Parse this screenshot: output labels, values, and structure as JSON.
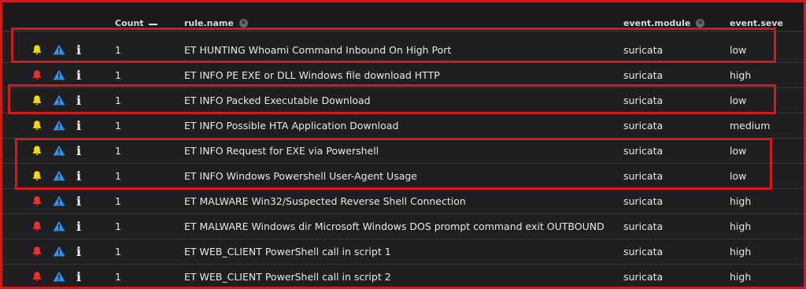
{
  "columns": {
    "count": "Count",
    "rule_name": "rule.name",
    "event_module": "event.module",
    "event_severity": "event.seve"
  },
  "colors": {
    "bell_yellow": "#f5d90a",
    "bell_red": "#e5342f",
    "warning_blue": "#3b8ee8",
    "highlight_red": "#d11a1a"
  },
  "rows": [
    {
      "bell": "yellow",
      "count": "1",
      "rule_name": "ET HUNTING Whoami Command Inbound On High Port",
      "module": "suricata",
      "severity": "low"
    },
    {
      "bell": "red",
      "count": "1",
      "rule_name": "ET INFO PE EXE or DLL Windows file download HTTP",
      "module": "suricata",
      "severity": "high"
    },
    {
      "bell": "yellow",
      "count": "1",
      "rule_name": "ET INFO Packed Executable Download",
      "module": "suricata",
      "severity": "low"
    },
    {
      "bell": "yellow",
      "count": "1",
      "rule_name": "ET INFO Possible HTA Application Download",
      "module": "suricata",
      "severity": "medium"
    },
    {
      "bell": "yellow",
      "count": "1",
      "rule_name": "ET INFO Request for EXE via Powershell",
      "module": "suricata",
      "severity": "low"
    },
    {
      "bell": "yellow",
      "count": "1",
      "rule_name": "ET INFO Windows Powershell User-Agent Usage",
      "module": "suricata",
      "severity": "low"
    },
    {
      "bell": "red",
      "count": "1",
      "rule_name": "ET MALWARE Win32/Suspected Reverse Shell Connection",
      "module": "suricata",
      "severity": "high"
    },
    {
      "bell": "red",
      "count": "1",
      "rule_name": "ET MALWARE Windows dir Microsoft Windows DOS prompt command exit OUTBOUND",
      "module": "suricata",
      "severity": "high"
    },
    {
      "bell": "red",
      "count": "1",
      "rule_name": "ET WEB_CLIENT PowerShell call in script 1",
      "module": "suricata",
      "severity": "high"
    },
    {
      "bell": "red",
      "count": "1",
      "rule_name": "ET WEB_CLIENT PowerShell call in script 2",
      "module": "suricata",
      "severity": "high"
    }
  ]
}
